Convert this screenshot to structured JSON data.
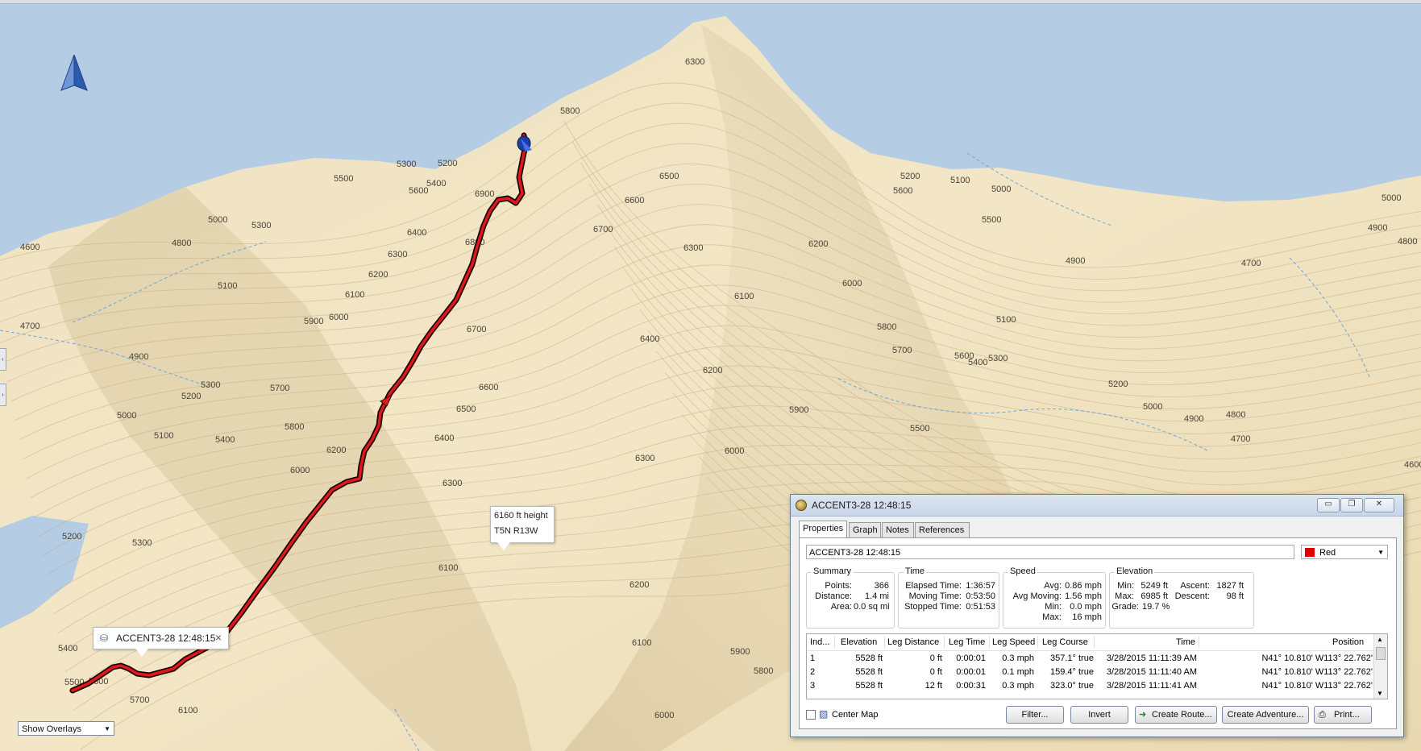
{
  "map": {
    "contour_labels": [
      {
        "t": "6300"
      },
      {
        "t": "5800"
      },
      {
        "t": "5300"
      },
      {
        "t": "5200"
      },
      {
        "t": "5500"
      },
      {
        "t": "5400"
      },
      {
        "t": "5600"
      },
      {
        "t": "6900"
      },
      {
        "t": "6500"
      },
      {
        "t": "6600"
      },
      {
        "t": "5200"
      },
      {
        "t": "5100"
      },
      {
        "t": "5000"
      },
      {
        "t": "5600"
      },
      {
        "t": "5000"
      },
      {
        "t": "5500"
      },
      {
        "t": "5000"
      },
      {
        "t": "4600"
      },
      {
        "t": "4800"
      },
      {
        "t": "5300"
      },
      {
        "t": "6400"
      },
      {
        "t": "6700"
      },
      {
        "t": "6300"
      },
      {
        "t": "6200"
      },
      {
        "t": "4900"
      },
      {
        "t": "4800"
      },
      {
        "t": "4700"
      },
      {
        "t": "4900"
      },
      {
        "t": "6300"
      },
      {
        "t": "6800"
      },
      {
        "t": "5100"
      },
      {
        "t": "6200"
      },
      {
        "t": "6100"
      },
      {
        "t": "6000"
      },
      {
        "t": "5900"
      },
      {
        "t": "6000"
      },
      {
        "t": "6100"
      },
      {
        "t": "5100"
      },
      {
        "t": "4700"
      },
      {
        "t": "5800"
      },
      {
        "t": "5700"
      },
      {
        "t": "5600"
      },
      {
        "t": "5400"
      },
      {
        "t": "5300"
      },
      {
        "t": "4900"
      },
      {
        "t": "6700"
      },
      {
        "t": "6400"
      },
      {
        "t": "6200"
      },
      {
        "t": "5300"
      },
      {
        "t": "5200"
      },
      {
        "t": "5700"
      },
      {
        "t": "6600"
      },
      {
        "t": "6500"
      },
      {
        "t": "5000"
      },
      {
        "t": "5800"
      },
      {
        "t": "5200"
      },
      {
        "t": "5000"
      },
      {
        "t": "4900"
      },
      {
        "t": "4800"
      },
      {
        "t": "5400"
      },
      {
        "t": "5100"
      },
      {
        "t": "6400"
      },
      {
        "t": "5900"
      },
      {
        "t": "5500"
      },
      {
        "t": "4700"
      },
      {
        "t": "6200"
      },
      {
        "t": "6000"
      },
      {
        "t": "6300"
      },
      {
        "t": "4600"
      },
      {
        "t": "6000"
      },
      {
        "t": "6300"
      },
      {
        "t": "5200"
      },
      {
        "t": "5300"
      },
      {
        "t": "6100"
      },
      {
        "t": "6200"
      },
      {
        "t": "6100"
      },
      {
        "t": "5900"
      },
      {
        "t": "5800"
      },
      {
        "t": "5400"
      },
      {
        "t": "5500"
      },
      {
        "t": "5600"
      },
      {
        "t": "5700"
      },
      {
        "t": "6100"
      },
      {
        "t": "6000"
      }
    ]
  },
  "track_popup": {
    "label": "ACCENT3-28 12:48:15",
    "close": "×"
  },
  "point_popup": {
    "height": "6160 ft height",
    "grid": "T5N R13W"
  },
  "overlay_select": {
    "value": "Show Overlays"
  },
  "window": {
    "title": "ACCENT3-28 12:48:15",
    "controls": {
      "minimize": "▭",
      "restore": "❐",
      "close": "✕"
    },
    "tabs": [
      {
        "label": "Properties",
        "active": true
      },
      {
        "label": "Graph",
        "active": false
      },
      {
        "label": "Notes",
        "active": false
      },
      {
        "label": "References",
        "active": false
      }
    ],
    "name_value": "ACCENT3-28 12:48:15",
    "color": {
      "label": "Red",
      "hex": "#e00000"
    },
    "summary": {
      "title": "Summary",
      "points_label": "Points:",
      "points": "366",
      "distance_label": "Distance:",
      "distance": "1.4 mi",
      "area_label": "Area:",
      "area": "0.0 sq mi"
    },
    "time": {
      "title": "Time",
      "elapsed_label": "Elapsed Time:",
      "elapsed": "1:36:57",
      "moving_label": "Moving Time:",
      "moving": "0:53:50",
      "stopped_label": "Stopped Time:",
      "stopped": "0:51:53"
    },
    "speed": {
      "title": "Speed",
      "avg_label": "Avg:",
      "avg": "0.86 mph",
      "avg_moving_label": "Avg Moving:",
      "avg_moving": "1.56 mph",
      "min_label": "Min:",
      "min": "0.0 mph",
      "max_label": "Max:",
      "max": "16 mph"
    },
    "elevation": {
      "title": "Elevation",
      "min_label": "Min:",
      "min": "5249 ft",
      "max_label": "Max:",
      "max": "6985 ft",
      "grade_label": "Grade:",
      "grade": "19.7 %",
      "ascent_label": "Ascent:",
      "ascent": "1827 ft",
      "descent_label": "Descent:",
      "descent": "98 ft"
    },
    "table": {
      "headers": [
        "Ind...",
        "Elevation",
        "Leg Distance",
        "Leg Time",
        "Leg Speed",
        "Leg Course",
        "Time",
        "Position"
      ],
      "rows": [
        [
          "1",
          "5528 ft",
          "0 ft",
          "0:00:01",
          "0.3 mph",
          "357.1° true",
          "3/28/2015 11:11:39 AM",
          "N41° 10.810' W113° 22.762'"
        ],
        [
          "2",
          "5528 ft",
          "0 ft",
          "0:00:01",
          "0.1 mph",
          "159.4° true",
          "3/28/2015 11:11:40 AM",
          "N41° 10.810' W113° 22.762'"
        ],
        [
          "3",
          "5528 ft",
          "12 ft",
          "0:00:31",
          "0.3 mph",
          "323.0° true",
          "3/28/2015 11:11:41 AM",
          "N41° 10.810' W113° 22.762'"
        ]
      ]
    },
    "center_map_label": "Center Map",
    "buttons": {
      "filter": "Filter...",
      "invert": "Invert",
      "create_route": "Create Route...",
      "create_adventure": "Create Adventure...",
      "print": "Print..."
    }
  }
}
